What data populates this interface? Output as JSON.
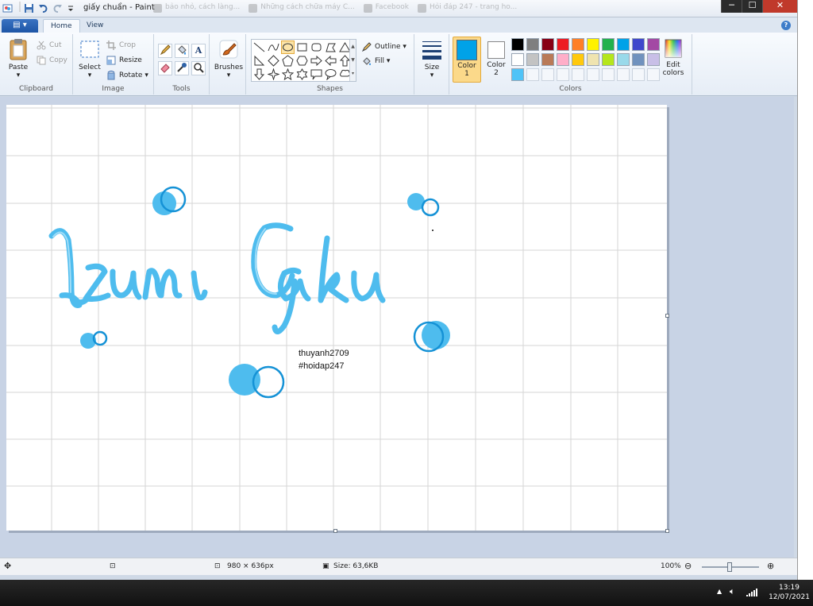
{
  "window": {
    "title": "giấy chuẩn - Paint",
    "background_tabs": [
      "bảo nhỏ, cách làng...",
      "Những cách chữa máy C...",
      "Facebook",
      "Hỏi đáp 247 - trang ho..."
    ],
    "controls": {
      "minimize": "─",
      "maximize": "☐",
      "close": "✕"
    }
  },
  "ribbon_tabs": {
    "file": "▤ ▾",
    "home": "Home",
    "view": "View"
  },
  "clipboard": {
    "paste": "Paste",
    "cut": "Cut",
    "copy": "Copy",
    "label": "Clipboard"
  },
  "image": {
    "select": "Select",
    "crop": "Crop",
    "resize": "Resize",
    "rotate": "Rotate",
    "label": "Image"
  },
  "tools": {
    "label": "Tools",
    "text_tool": "A"
  },
  "brushes": {
    "label": "Brushes"
  },
  "shapes": {
    "outline": "Outline",
    "fill": "Fill",
    "label": "Shapes"
  },
  "size": {
    "label": "Size"
  },
  "colors": {
    "color1": "Color\n1",
    "color1_line1": "Color",
    "color1_line2": "1",
    "color2_line1": "Color",
    "color2_line2": "2",
    "edit_line1": "Edit",
    "edit_line2": "colors",
    "label": "Colors",
    "color1_value": "#00a2e8",
    "color2_value": "#ffffff",
    "palette_row1": [
      "#000000",
      "#7f7f7f",
      "#880015",
      "#ed1c24",
      "#ff7f27",
      "#fff200",
      "#22b14c",
      "#00a2e8",
      "#3f48cc",
      "#a349a4"
    ],
    "palette_row2": [
      "#ffffff",
      "#c3c3c3",
      "#b97a57",
      "#ffaec9",
      "#ffc90e",
      "#efe4b0",
      "#b5e61d",
      "#99d9ea",
      "#7092be",
      "#c8bfe7"
    ],
    "palette_row3": [
      "#4fc3f7"
    ]
  },
  "canvas": {
    "drawing_text": "Izumi Gaku",
    "drawing_color": "#4ebcee",
    "credit_line1": "thuyanh2709",
    "credit_line2": "#hoidap247"
  },
  "status": {
    "dimensions": "980 × 636px",
    "size": "Size: 63,6KB",
    "zoom": "100%"
  },
  "taskbar": {
    "time": "13:19",
    "date": "12/07/2021"
  }
}
